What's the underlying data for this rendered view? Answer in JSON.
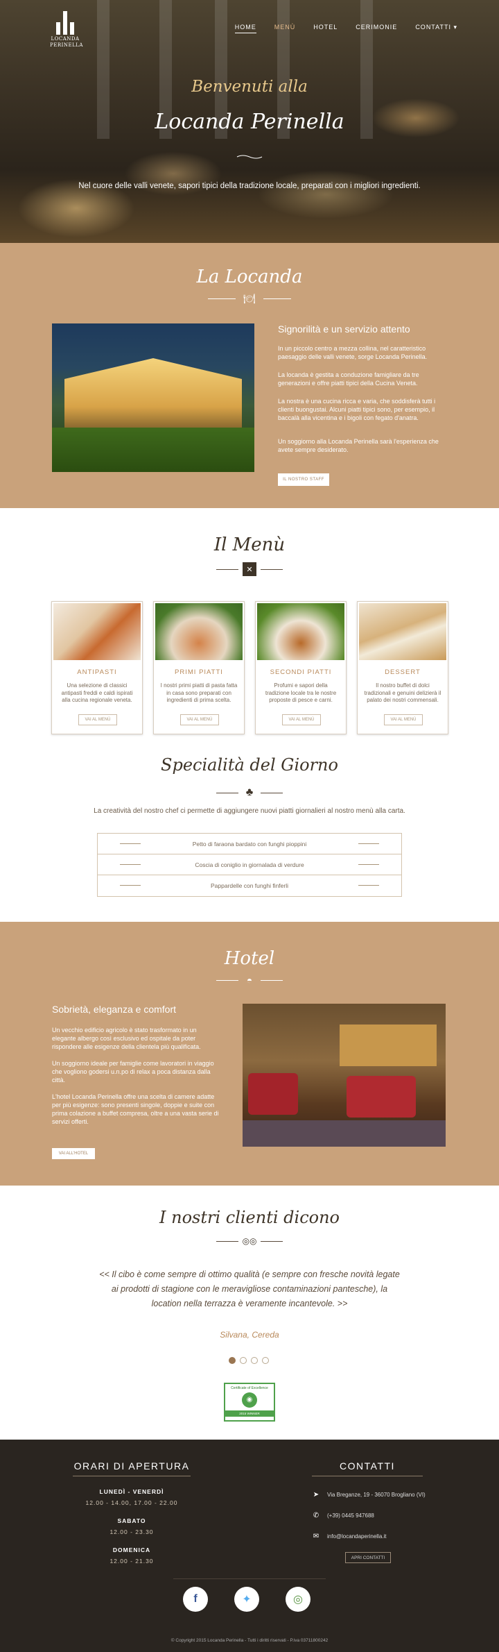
{
  "nav": {
    "logo_text": "LOCANDA\nPERINELLA",
    "items": [
      "HOME",
      "MENÙ",
      "HOTEL",
      "CERIMONIE",
      "CONTATTI ▾"
    ]
  },
  "hero": {
    "subtitle": "Benvenuti alla",
    "title": "Locanda Perinella",
    "text": "Nel cuore delle valli venete, sapori tipici della tradizione locale, preparati con i migliori ingredienti."
  },
  "locanda": {
    "title": "La Locanda",
    "heading": "Signorilità e un servizio attento",
    "paragraphs": [
      "In un piccolo centro a mezza collina, nel caratteristico paesaggio delle valli venete, sorge Locanda Perinella.",
      "La locanda è gestita a conduzione famigliare da tre generazioni e offre piatti tipici della Cucina Veneta.",
      "La nostra è una cucina ricca e varia, che soddisferà tutti i clienti buongustai. Alcuni piatti tipici sono, per esempio, il baccalà alla vicentina e i bigoli con fegato d'anatra.",
      "Un soggiorno alla Locanda Perinella sarà l'esperienza che avete sempre desiderato."
    ],
    "button": "IL NOSTRO STAFF"
  },
  "menu": {
    "title": "Il Menù",
    "cards": [
      {
        "title": "ANTIPASTI",
        "desc": "Una selezione di classici antipasti freddi e caldi ispirati alla cucina regionale veneta.",
        "button": "VAI AL MENÙ"
      },
      {
        "title": "PRIMI PIATTI",
        "desc": "I nostri primi piatti di pasta fatta in casa sono preparati con ingredienti di prima scelta.",
        "button": "VAI AL MENÙ"
      },
      {
        "title": "SECONDI PIATTI",
        "desc": "Profumi e sapori della tradizione locale tra le nostre proposte di pesce e carni.",
        "button": "VAI AL MENÙ"
      },
      {
        "title": "DESSERT",
        "desc": "Il nostro buffet di dolci tradizionali e genuini delizierà il palato dei nostri commensali.",
        "button": "VAI AL MENÙ"
      }
    ]
  },
  "specialita": {
    "title": "Specialità del Giorno",
    "text": "La creatività del nostro chef ci permette di aggiungere nuovi piatti giornalieri al nostro menù alla carta.",
    "items": [
      "Petto di faraona bardato con funghi pioppini",
      "Coscia di coniglio in giornalada di verdure",
      "Pappardelle con funghi finferli"
    ]
  },
  "hotel": {
    "title": "Hotel",
    "heading": "Sobrietà, eleganza e comfort",
    "paragraphs": [
      "Un vecchio edificio agricolo è stato trasformato in un elegante albergo così esclusivo ed ospitale da poter rispondere alle esigenze della clientela più qualificata.",
      "Un soggiorno ideale per famiglie come lavoratori in viaggio che vogliono godersi u.n.po di relax a poca distanza dalla città.",
      "L'hotel Locanda Perinella offre una scelta di camere adatte per più esigenze: sono presenti singole, doppie e suite con prima colazione a buffet compresa, oltre a una vasta serie di servizi offerti."
    ],
    "button": "VAI ALL'HOTEL"
  },
  "testimonials": {
    "title": "I nostri clienti dicono",
    "quote": "<< Il cibo è come sempre di ottimo qualità (e sempre con fresche novità legate ai prodotti di stagione con le meravigliose contaminazioni pantesche), la location nella terrazza è veramente incantevole. >>",
    "author": "Silvana, Cereda",
    "badge_top": "Certificate of Excellence",
    "badge_bottom": "2015 WINNER"
  },
  "footer": {
    "hours_title": "ORARI DI APERTURA",
    "hours": [
      {
        "day": "LUNEDÌ - VENERDÌ",
        "time": "12.00 - 14.00, 17.00 - 22.00"
      },
      {
        "day": "SABATO",
        "time": "12.00 - 23.30"
      },
      {
        "day": "DOMENICA",
        "time": "12.00 - 21.30"
      }
    ],
    "contact_title": "CONTATTI",
    "address": "Via Breganze, 19 - 36070 Brogliano (VI)",
    "phone": "(+39) 0445 947688",
    "email": "info@locandaperinella.it",
    "contact_button": "APRI CONTATTI",
    "copyright": "© Copyright 2015 Locanda Perinella - Tutti i diritti riservati - P.iva 03711800242"
  },
  "colors": {
    "tan": "#c9a27b",
    "dark": "#2a2520",
    "accent": "#b8895a"
  }
}
